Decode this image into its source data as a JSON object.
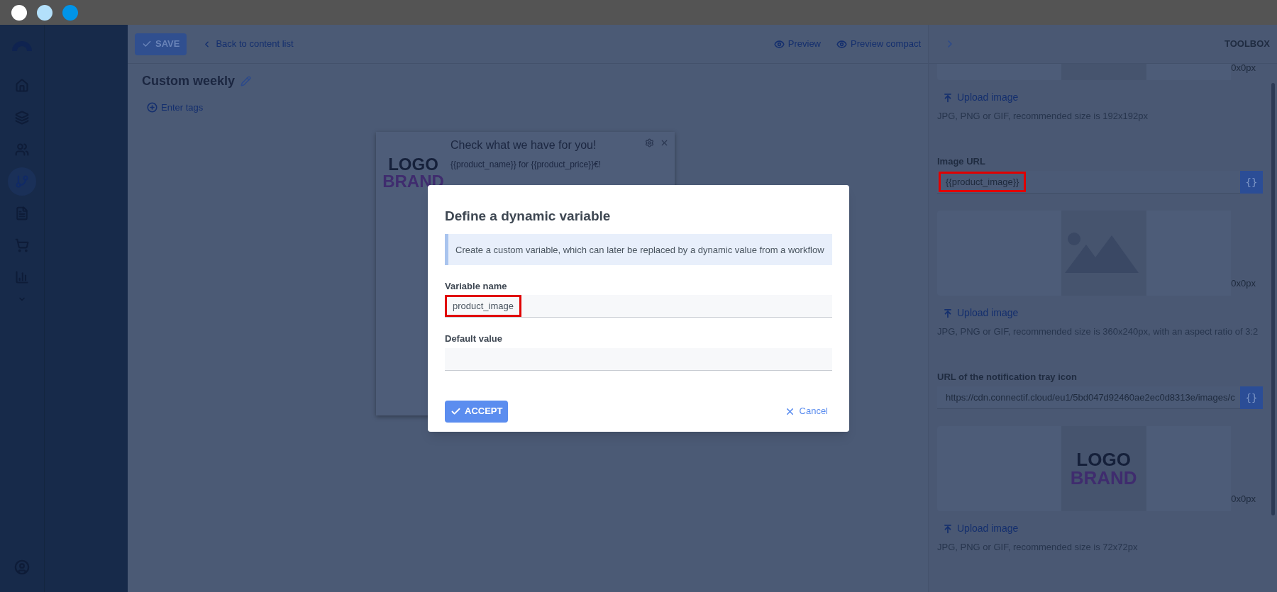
{
  "window_controls": [
    {
      "color": "#ffffff"
    },
    {
      "color": "#b3e0fb"
    },
    {
      "color": "#0094e8"
    }
  ],
  "sidebar": {
    "items": [
      {
        "selected": false
      },
      {
        "selected": false
      },
      {
        "selected": false
      },
      {
        "selected": true
      },
      {
        "selected": false
      },
      {
        "selected": false
      },
      {
        "selected": false
      }
    ]
  },
  "toolbar": {
    "save": "SAVE",
    "back": "Back to content list",
    "preview": "Preview",
    "preview_compact": "Preview compact"
  },
  "content": {
    "title": "Custom weekly",
    "tags": "Enter tags"
  },
  "notification": {
    "logo_top": "LOGO",
    "logo_bottom": "BRAND",
    "title": "Check what we have for you!",
    "body": "{{product_name}} for {{product_price}}€!"
  },
  "toolbox": {
    "title": "TOOLBOX",
    "sections": [
      {
        "kind": "image",
        "preview": {
          "kind": "empty"
        },
        "size": "0x0px",
        "upload": "Upload image",
        "hint": "JPG, PNG or GIF, recommended size is 192x192px"
      },
      {
        "kind": "url",
        "label": "Image URL",
        "value": "{{product_image}}",
        "highlighted": true,
        "button": "{}"
      },
      {
        "kind": "image",
        "preview": {
          "kind": "placeholder"
        },
        "size": "0x0px",
        "upload": "Upload image",
        "hint": "JPG, PNG or GIF, recommended size is 360x240px, with an aspect ratio of 3:2"
      },
      {
        "kind": "url",
        "label": "URL of the notification tray icon",
        "value": "https://cdn.connectif.cloud/eu1/5bd047d92460ae2ec0d8313e/images/c",
        "highlighted": false,
        "button": "{}"
      },
      {
        "kind": "image",
        "preview": {
          "kind": "logo",
          "logo_top": "LOGO",
          "logo_bottom": "BRAND"
        },
        "size": "0x0px",
        "upload": "Upload image",
        "hint": "JPG, PNG or GIF, recommended size is 72x72px"
      }
    ]
  },
  "dialog": {
    "title": "Define a dynamic variable",
    "info": "Create a custom variable, which can later be replaced by a dynamic value from a workflow",
    "fields": [
      {
        "label": "Variable name",
        "value": "product_image",
        "highlighted": true
      },
      {
        "label": "Default value",
        "highlighted": false
      }
    ],
    "accept": "ACCEPT",
    "cancel": "Cancel"
  }
}
